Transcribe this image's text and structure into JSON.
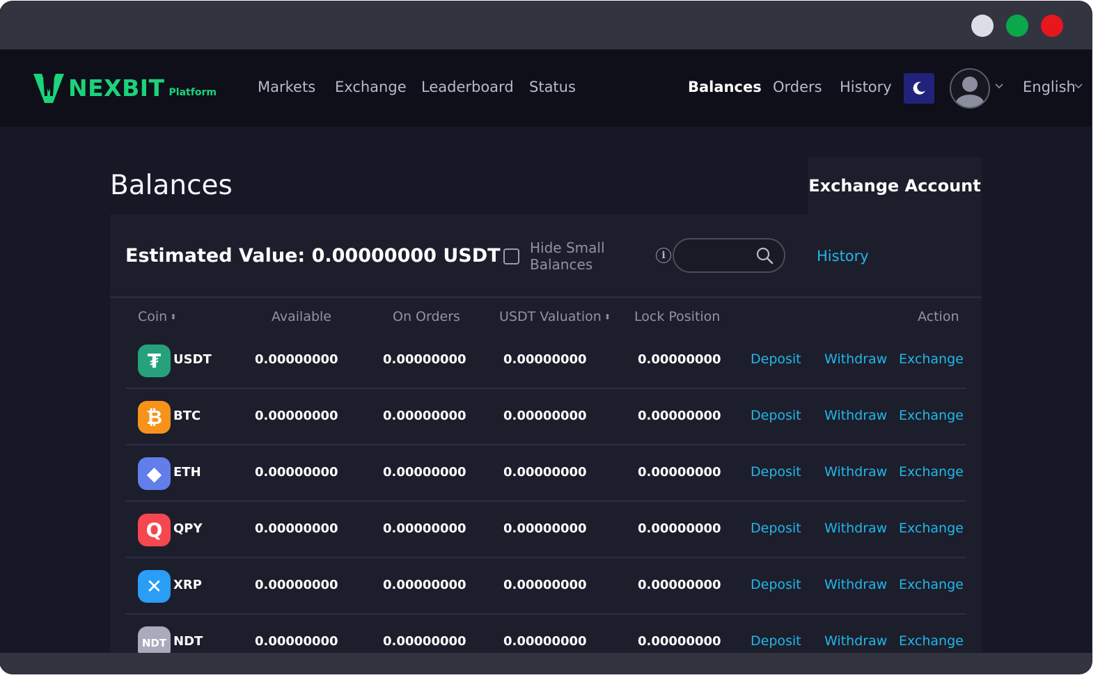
{
  "brand": {
    "name": "NEXBIT",
    "sub": "Platform",
    "color": "#1bd37a"
  },
  "nav": {
    "left": [
      "Markets",
      "Exchange",
      "Leaderboard",
      "Status"
    ],
    "right": [
      "Balances",
      "Orders",
      "History"
    ],
    "active": "Balances",
    "language": "English"
  },
  "page": {
    "title": "Balances",
    "account_tab": "Exchange Account",
    "estimated_value": "Estimated Value: 0.00000000 USDT",
    "hide_small": "Hide Small Balances",
    "hide_small_checked": false,
    "search_placeholder": "",
    "history_link": "History"
  },
  "table": {
    "columns": [
      "Coin",
      "Available",
      "On Orders",
      "USDT Valuation",
      "Lock Position",
      "Action"
    ],
    "actions": [
      "Deposit",
      "Withdraw",
      "Exchange"
    ],
    "rows": [
      {
        "coin": "USDT",
        "available": "0.00000000",
        "on_orders": "0.00000000",
        "usdt_valuation": "0.00000000",
        "lock_position": "0.00000000"
      },
      {
        "coin": "BTC",
        "available": "0.00000000",
        "on_orders": "0.00000000",
        "usdt_valuation": "0.00000000",
        "lock_position": "0.00000000"
      },
      {
        "coin": "ETH",
        "available": "0.00000000",
        "on_orders": "0.00000000",
        "usdt_valuation": "0.00000000",
        "lock_position": "0.00000000"
      },
      {
        "coin": "QPY",
        "available": "0.00000000",
        "on_orders": "0.00000000",
        "usdt_valuation": "0.00000000",
        "lock_position": "0.00000000"
      },
      {
        "coin": "XRP",
        "available": "0.00000000",
        "on_orders": "0.00000000",
        "usdt_valuation": "0.00000000",
        "lock_position": "0.00000000"
      },
      {
        "coin": "NDT",
        "available": "0.00000000",
        "on_orders": "0.00000000",
        "usdt_valuation": "0.00000000",
        "lock_position": "0.00000000"
      }
    ],
    "coin_icons": {
      "USDT": {
        "icon": "tether-icon",
        "color": "#26a17b",
        "glyph": "₮"
      },
      "BTC": {
        "icon": "bitcoin-icon",
        "color": "#f7931a",
        "glyph": "₿"
      },
      "ETH": {
        "icon": "ethereum-icon",
        "color": "#627eea",
        "glyph": "◆"
      },
      "QPY": {
        "icon": "qpy-icon",
        "color": "#f5474f",
        "glyph": "Q"
      },
      "XRP": {
        "icon": "ripple-icon",
        "color": "#2a9df4",
        "glyph": "✕"
      },
      "NDT": {
        "icon": "ndt-icon",
        "color": "#a9abbd",
        "glyph": "NDT"
      }
    }
  },
  "colors": {
    "link": "#20b8ea",
    "moon_button": "#23227a",
    "window_dots": [
      "#dcdde5",
      "#0aa84a",
      "#e8171d"
    ]
  }
}
